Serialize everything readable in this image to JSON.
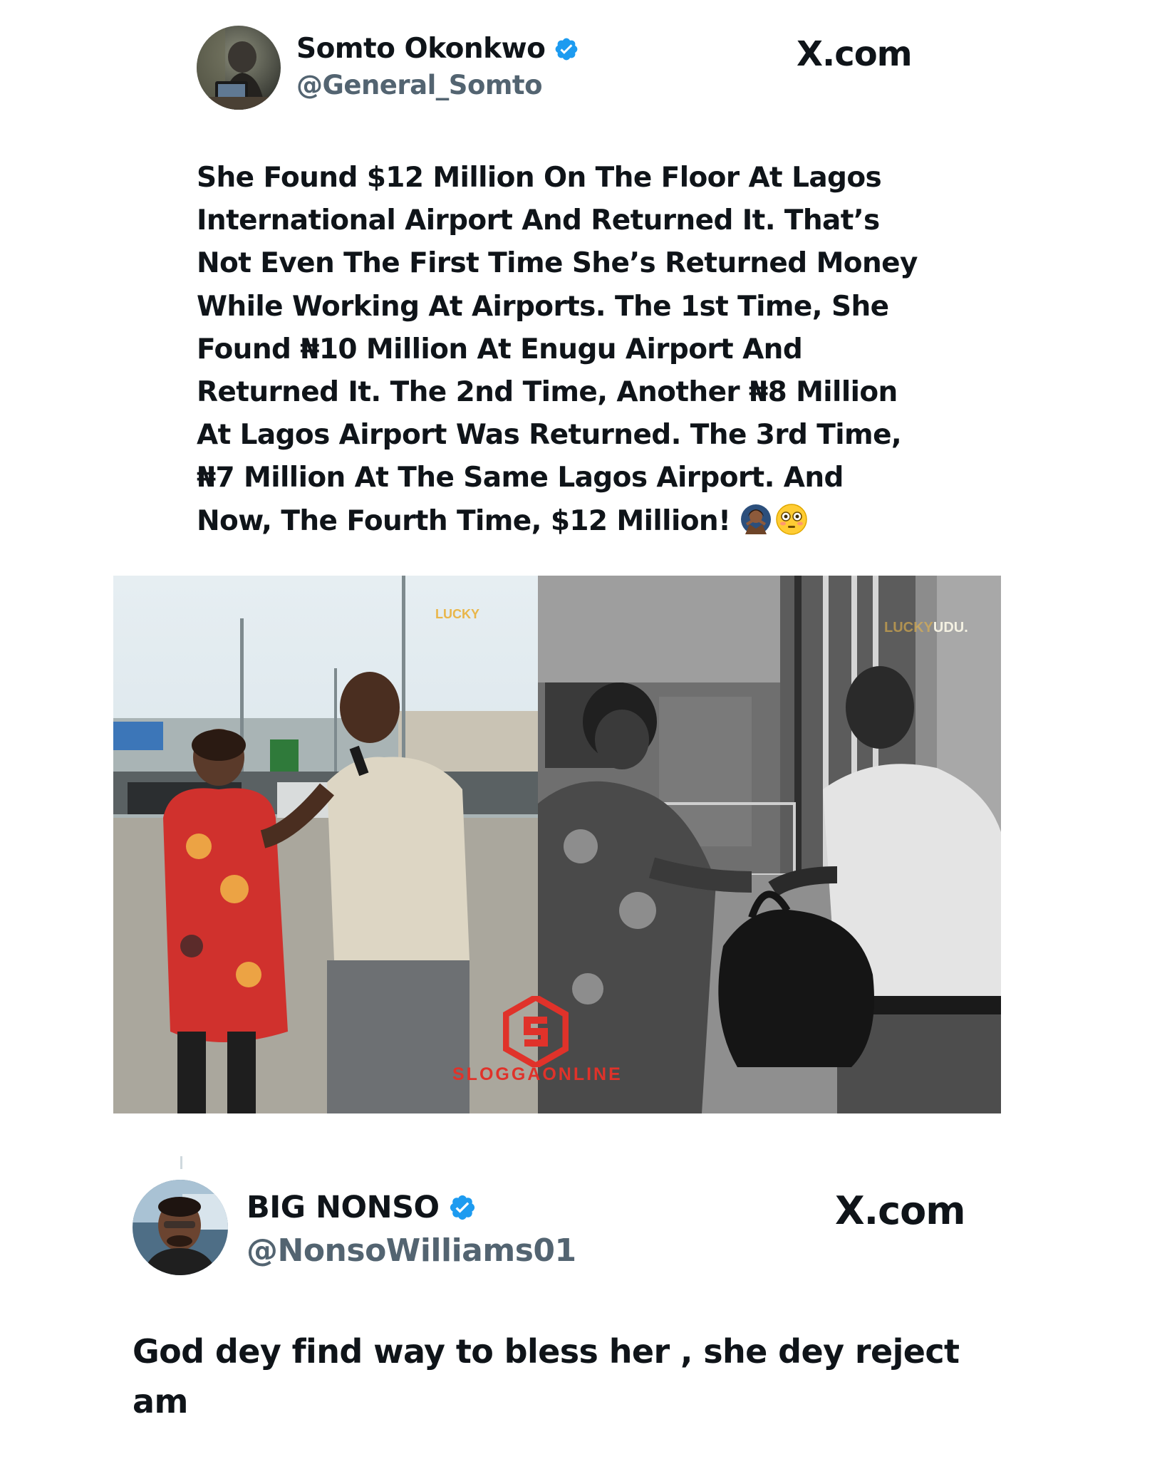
{
  "post": {
    "author_name": "Somto Okonkwo",
    "author_handle": "@General_Somto",
    "source_label": "X.com",
    "verified": true,
    "text_lines": [
      "She Found $12 Million On The Floor At Lagos",
      "International Airport And Returned It. That’s",
      "Not Even The First Time She’s Returned Money",
      "While Working At Airports. The 1st Time, She",
      "Found ₦10 Million At Enugu Airport And",
      "Returned It. The 2nd Time, Another ₦8 Million",
      "At Lagos Airport Was Returned. The 3rd Time,",
      "₦7 Million At The Same Lagos Airport. And",
      "Now, The Fourth Time, $12 Million!"
    ],
    "emojis": [
      "person-gesturing-no-emoji",
      "flushed-face-emoji"
    ],
    "media": {
      "left_watermark": "LUCKY",
      "right_watermark_prefix": "LUCKY",
      "right_watermark_suffix": "UDU.",
      "center_watermark": "SLOGGAONLINE",
      "left_panel": "color-photo-two-people-airport-parking",
      "right_panel": "grayscale-photo-handing-bag"
    }
  },
  "reply": {
    "author_name": "BIG NONSO",
    "author_handle": "@NonsoWilliams01",
    "source_label": "X.com",
    "verified": true,
    "text_lines": [
      "God dey find way to bless her , she dey reject",
      "am"
    ]
  },
  "colors": {
    "verified_blue": "#1d9bf0",
    "text": "#0f1419",
    "handle_gray": "#536471",
    "watermark_red": "#e0322a",
    "watermark_gold": "#e9b64a"
  }
}
